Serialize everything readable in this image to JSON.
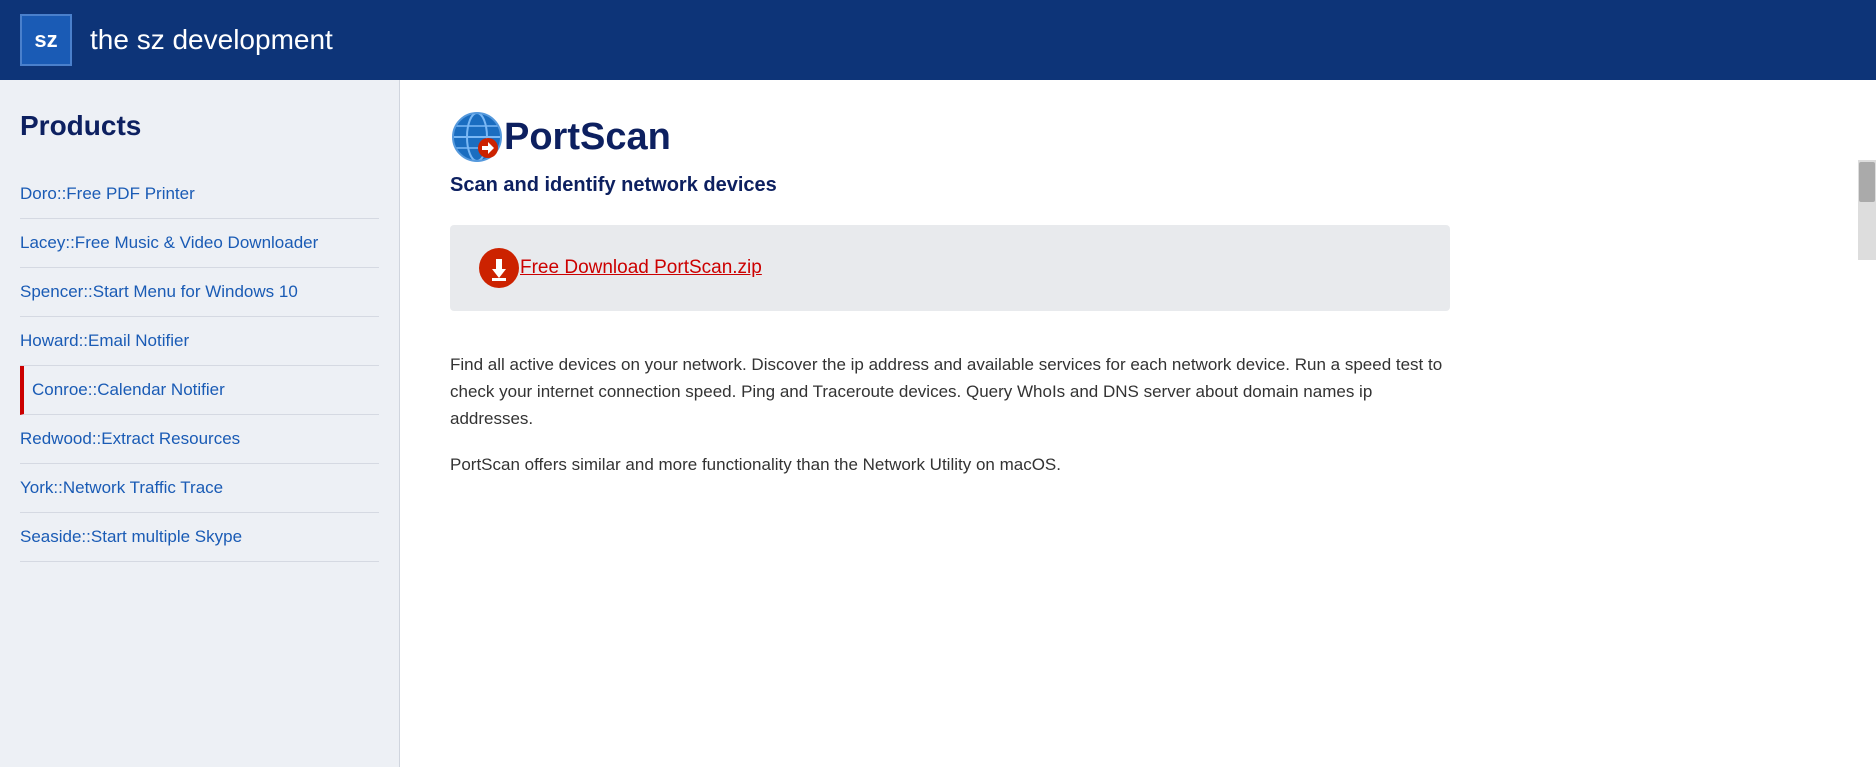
{
  "header": {
    "logo_text": "sz",
    "title": "the sz development"
  },
  "sidebar": {
    "heading": "Products",
    "items": [
      {
        "id": "doro",
        "label": "Doro::Free PDF Printer",
        "active": false
      },
      {
        "id": "lacey",
        "label": "Lacey::Free Music & Video Downloader",
        "active": false
      },
      {
        "id": "spencer",
        "label": "Spencer::Start Menu for Windows 10",
        "active": false
      },
      {
        "id": "howard",
        "label": "Howard::Email Notifier",
        "active": false
      },
      {
        "id": "conroe",
        "label": "Conroe::Calendar Notifier",
        "active": true
      },
      {
        "id": "redwood",
        "label": "Redwood::Extract Resources",
        "active": false
      },
      {
        "id": "york",
        "label": "York::Network Traffic Trace",
        "active": false
      },
      {
        "id": "seaside",
        "label": "Seaside::Start multiple Skype",
        "active": false
      }
    ]
  },
  "product": {
    "title": "PortScan",
    "subtitle": "Scan and identify network devices",
    "download_label": "Free Download PortScan.zip",
    "description_1": "Find all active devices on your network. Discover the ip address and available services for each network device. Run a speed test to check your internet connection speed. Ping and Traceroute devices. Query WhoIs and DNS server about domain names ip addresses.",
    "description_2": "PortScan offers similar and more functionality than the Network Utility on macOS."
  }
}
